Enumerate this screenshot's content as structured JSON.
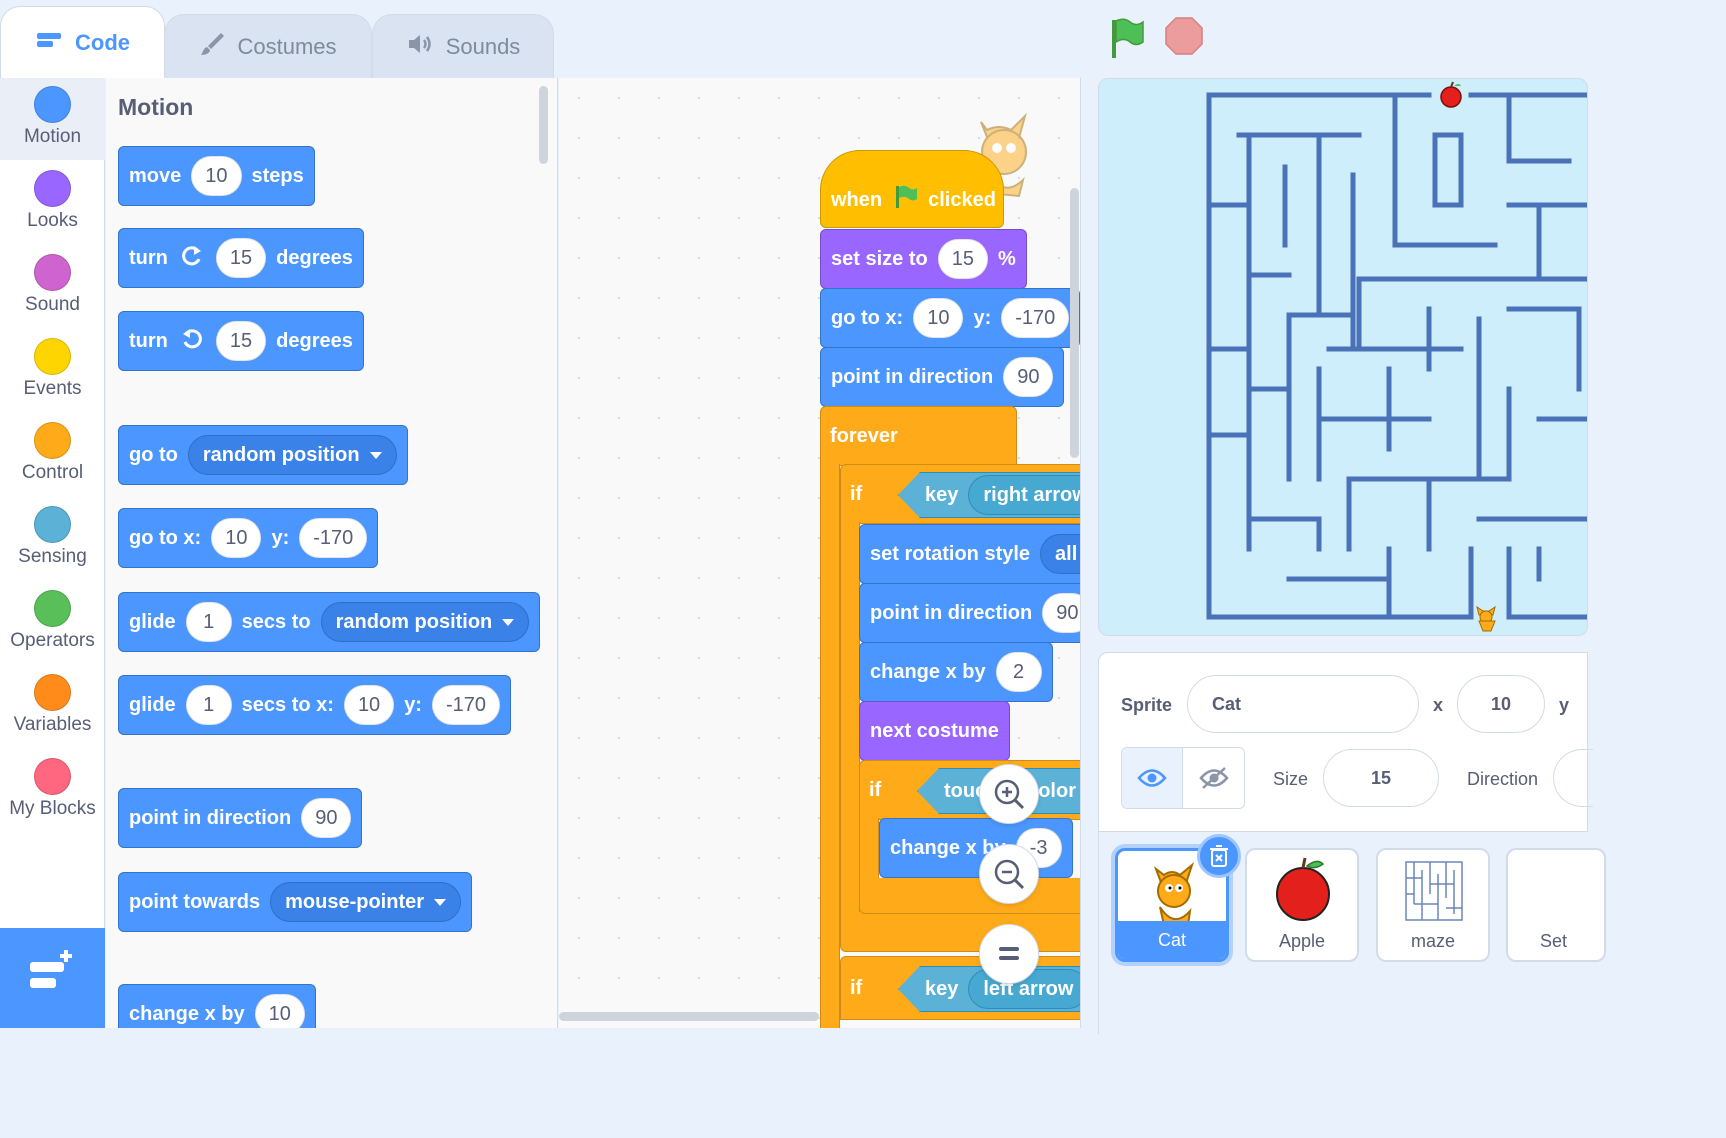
{
  "tabs": {
    "code": "Code",
    "costumes": "Costumes",
    "sounds": "Sounds"
  },
  "categories": [
    {
      "label": "Motion",
      "color": "#4c97ff"
    },
    {
      "label": "Looks",
      "color": "#9966ff"
    },
    {
      "label": "Sound",
      "color": "#cf63cf"
    },
    {
      "label": "Events",
      "color": "#ffd500"
    },
    {
      "label": "Control",
      "color": "#ffab19"
    },
    {
      "label": "Sensing",
      "color": "#5cb1d6"
    },
    {
      "label": "Operators",
      "color": "#59c059"
    },
    {
      "label": "Variables",
      "color": "#ff8c1a"
    },
    {
      "label": "My Blocks",
      "color": "#ff6680"
    }
  ],
  "palette": {
    "title": "Motion",
    "move": {
      "a": "move",
      "v": "10",
      "b": "steps"
    },
    "turn_right": {
      "a": "turn",
      "v": "15",
      "b": "degrees"
    },
    "turn_left": {
      "a": "turn",
      "v": "15",
      "b": "degrees"
    },
    "goto": {
      "a": "go to",
      "menu": "random position"
    },
    "goto_xy": {
      "a": "go to x:",
      "x": "10",
      "ylbl": "y:",
      "y": "-170"
    },
    "glide_to": {
      "a": "glide",
      "v": "1",
      "b": "secs to",
      "menu": "random position"
    },
    "glide_xy": {
      "a": "glide",
      "v": "1",
      "b": "secs to x:",
      "x": "10",
      "ylbl": "y:",
      "y": "-170"
    },
    "point_dir": {
      "a": "point in direction",
      "v": "90"
    },
    "point_towards": {
      "a": "point towards",
      "menu": "mouse-pointer"
    },
    "change_x": {
      "a": "change x by",
      "v": "10"
    }
  },
  "script": {
    "hat": {
      "a": "when",
      "b": "clicked"
    },
    "set_size": {
      "a": "set size to",
      "v": "15",
      "b": "%"
    },
    "goto_xy": {
      "a": "go to x:",
      "x": "10",
      "ylbl": "y:",
      "y": "-170"
    },
    "point_dir": {
      "a": "point in direction",
      "v": "90"
    },
    "forever": "forever",
    "if1": {
      "a": "if",
      "key": "key",
      "menu": "right arrow"
    },
    "rotation": {
      "a": "set rotation style",
      "menu": "all a"
    },
    "point_dir2": {
      "a": "point in direction",
      "v": "90"
    },
    "change_x": {
      "a": "change x by",
      "v": "2"
    },
    "next_costume": "next costume",
    "if2": {
      "a": "if",
      "sense": "touc",
      "sense_b": "olor"
    },
    "change_x2": {
      "a": "change x by",
      "v": "-3"
    },
    "if3": {
      "a": "if",
      "key": "key",
      "menu": "left arrow"
    }
  },
  "sprite_info": {
    "sprite_label": "Sprite",
    "sprite_name": "Cat",
    "x_label": "x",
    "x_value": "10",
    "y_label": "y",
    "size_label": "Size",
    "size_value": "15",
    "direction_label": "Direction"
  },
  "sprites": [
    {
      "name": "Cat",
      "selected": true
    },
    {
      "name": "Apple"
    },
    {
      "name": "maze"
    },
    {
      "name": "Set"
    }
  ]
}
